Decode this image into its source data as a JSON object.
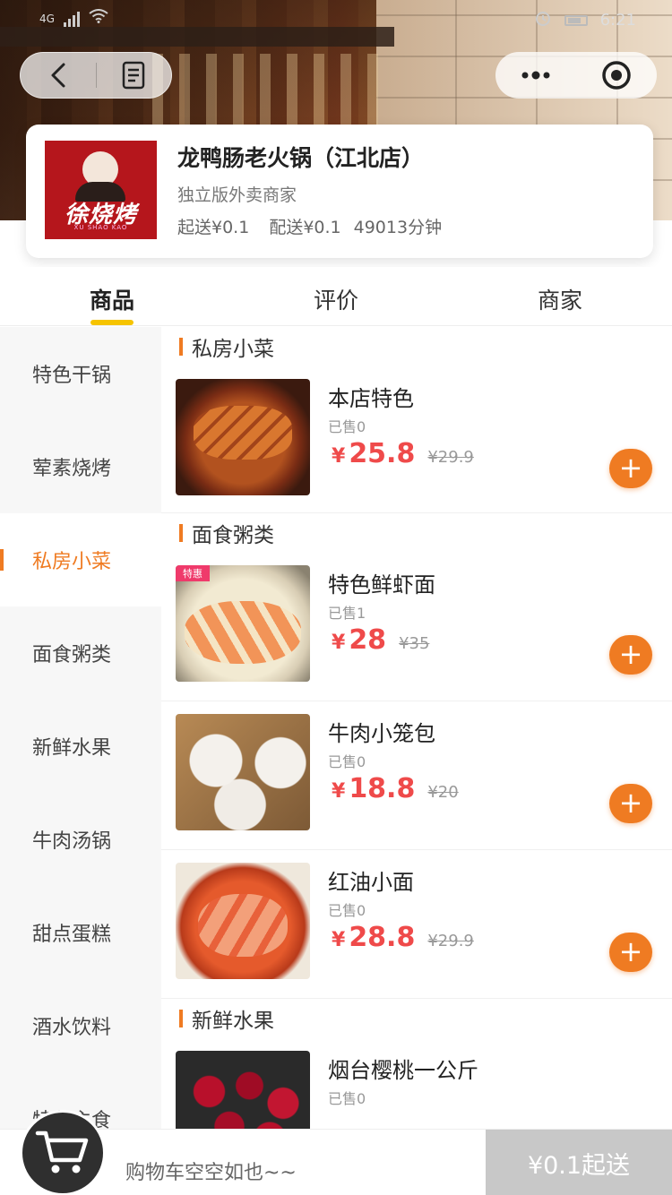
{
  "status_bar": {
    "network": "4G",
    "time": "6:21"
  },
  "shop": {
    "name": "龙鸭肠老火锅（江北店）",
    "tag": "独立版外卖商家",
    "min_order": "起送¥0.1",
    "delivery_fee": "配送¥0.1",
    "delivery_time": "49013分钟",
    "logo_text": "徐烧烤",
    "logo_subtext": "XU SHAO KAO"
  },
  "tabs": [
    {
      "label": "商品",
      "active": true
    },
    {
      "label": "评价",
      "active": false
    },
    {
      "label": "商家",
      "active": false
    }
  ],
  "categories": [
    {
      "label": "特色干锅",
      "active": false
    },
    {
      "label": "荤素烧烤",
      "active": false
    },
    {
      "label": "私房小菜",
      "active": true
    },
    {
      "label": "面食粥类",
      "active": false
    },
    {
      "label": "新鲜水果",
      "active": false
    },
    {
      "label": "牛肉汤锅",
      "active": false
    },
    {
      "label": "甜点蛋糕",
      "active": false
    },
    {
      "label": "酒水饮料",
      "active": false
    },
    {
      "label": "特色主食",
      "active": false
    }
  ],
  "sections": [
    {
      "title": "私房小菜",
      "items": [
        {
          "name": "本店特色",
          "sold": "已售0",
          "currency": "¥",
          "price": "25.8",
          "old_price": "¥29.9",
          "badge": ""
        }
      ]
    },
    {
      "title": "面食粥类",
      "items": [
        {
          "name": "特色鲜虾面",
          "sold": "已售1",
          "currency": "¥",
          "price": "28",
          "old_price": "¥35",
          "badge": "特惠"
        },
        {
          "name": "牛肉小笼包",
          "sold": "已售0",
          "currency": "¥",
          "price": "18.8",
          "old_price": "¥20",
          "badge": ""
        },
        {
          "name": "红油小面",
          "sold": "已售0",
          "currency": "¥",
          "price": "28.8",
          "old_price": "¥29.9",
          "badge": ""
        }
      ]
    },
    {
      "title": "新鲜水果",
      "items": [
        {
          "name": "烟台樱桃一公斤",
          "sold": "已售0"
        }
      ]
    }
  ],
  "cart": {
    "empty_text": "购物车空空如也~~",
    "submit_label": "¥0.1起送"
  },
  "icons": {
    "back": "chevron-left-icon",
    "notes": "document-icon",
    "more": "more-dots-icon",
    "close": "target-circle-icon",
    "cart": "shopping-cart-icon",
    "add": "plus-icon"
  },
  "colors": {
    "accent": "#ef7b22",
    "price": "#ef4a4a",
    "tab_indicator": "#f6c400",
    "logo_bg": "#b5161c",
    "cart_disabled": "#c8c8c8"
  }
}
